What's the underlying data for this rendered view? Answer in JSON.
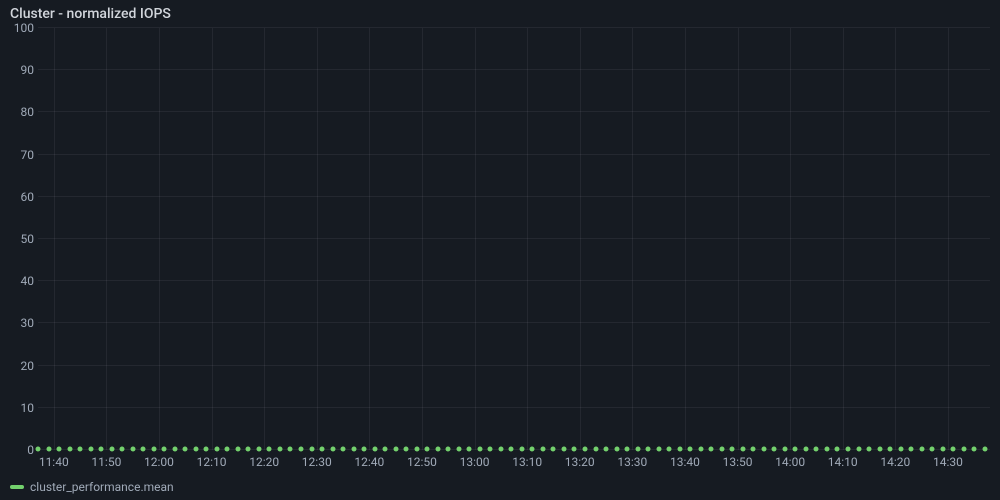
{
  "title": "Cluster - normalized IOPS",
  "legend": {
    "series0": "cluster_performance.mean"
  },
  "colors": {
    "series0": "#73d16d",
    "grid": "rgba(204,204,220,0.08)",
    "text": "#a0aab8",
    "bg": "#161b22"
  },
  "y_ticks": [
    "0",
    "10",
    "20",
    "30",
    "40",
    "50",
    "60",
    "70",
    "80",
    "90",
    "100"
  ],
  "x_ticks": [
    "11:40",
    "11:50",
    "12:00",
    "12:10",
    "12:20",
    "12:30",
    "12:40",
    "12:50",
    "13:00",
    "13:10",
    "13:20",
    "13:30",
    "13:40",
    "13:50",
    "14:00",
    "14:10",
    "14:20",
    "14:30"
  ],
  "chart_data": {
    "type": "line",
    "title": "Cluster - normalized IOPS",
    "xlabel": "",
    "ylabel": "",
    "ylim": [
      0,
      100
    ],
    "x_range": [
      "11:37",
      "14:38"
    ],
    "series": [
      {
        "name": "cluster_performance.mean",
        "color": "#73d16d",
        "x": [
          "11:37",
          "11:39",
          "11:41",
          "11:43",
          "11:45",
          "11:47",
          "11:49",
          "11:51",
          "11:53",
          "11:55",
          "11:57",
          "11:59",
          "12:01",
          "12:03",
          "12:05",
          "12:07",
          "12:09",
          "12:11",
          "12:13",
          "12:15",
          "12:17",
          "12:19",
          "12:21",
          "12:23",
          "12:25",
          "12:27",
          "12:29",
          "12:31",
          "12:33",
          "12:35",
          "12:37",
          "12:39",
          "12:41",
          "12:43",
          "12:45",
          "12:47",
          "12:49",
          "12:51",
          "12:53",
          "12:55",
          "12:57",
          "12:59",
          "13:01",
          "13:03",
          "13:05",
          "13:07",
          "13:09",
          "13:11",
          "13:13",
          "13:15",
          "13:17",
          "13:19",
          "13:21",
          "13:23",
          "13:25",
          "13:27",
          "13:29",
          "13:31",
          "13:33",
          "13:35",
          "13:37",
          "13:39",
          "13:41",
          "13:43",
          "13:45",
          "13:47",
          "13:49",
          "13:51",
          "13:53",
          "13:55",
          "13:57",
          "13:59",
          "14:01",
          "14:03",
          "14:05",
          "14:07",
          "14:09",
          "14:11",
          "14:13",
          "14:15",
          "14:17",
          "14:19",
          "14:21",
          "14:23",
          "14:25",
          "14:27",
          "14:29",
          "14:31",
          "14:33",
          "14:35",
          "14:37"
        ],
        "values": [
          0,
          0,
          0,
          0,
          0,
          0,
          0,
          0,
          0,
          0,
          0,
          0,
          0,
          0,
          0,
          0,
          0,
          0,
          0,
          0,
          0,
          0,
          0,
          0,
          0,
          0,
          0,
          0,
          0,
          0,
          0,
          0,
          0,
          0,
          0,
          0,
          0,
          0,
          0,
          0,
          0,
          0,
          0,
          0,
          0,
          0,
          0,
          0,
          0,
          0,
          0,
          0,
          0,
          0,
          0,
          0,
          0,
          0,
          0,
          0,
          0,
          0,
          0,
          0,
          0,
          0,
          0,
          0,
          0,
          0,
          0,
          0,
          0,
          0,
          0,
          0,
          0,
          0,
          0,
          0,
          0,
          0,
          0,
          0,
          0,
          0,
          0,
          0,
          0,
          0,
          0
        ]
      }
    ]
  }
}
